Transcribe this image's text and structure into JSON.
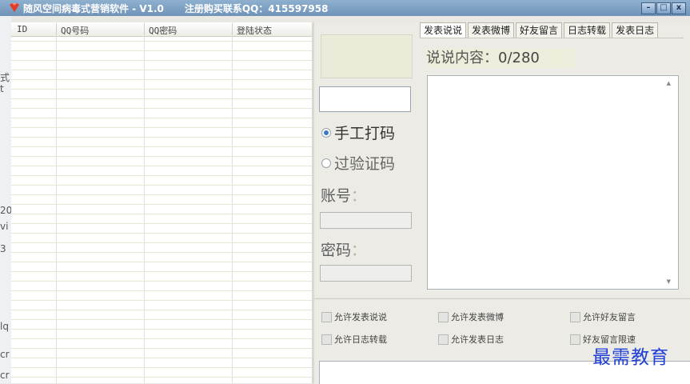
{
  "window": {
    "title": "随风空间病毒式营销软件 - V1.0",
    "contact": "注册购买联系QQ：415597958",
    "controls": [
      "–",
      "□",
      "x"
    ]
  },
  "left_strip_chars": [
    "式",
    "t",
    "20",
    "vi",
    "3",
    "lq",
    "cr",
    "cr"
  ],
  "account_table": {
    "columns": [
      "ID",
      "QQ号码",
      "QQ密码",
      "登陆状态"
    ],
    "rows": []
  },
  "login": {
    "radio_manual": "手工打码",
    "radio_auto": "过验证码",
    "account_label": "账号",
    "password_label": "密码",
    "colon": "："
  },
  "tabs": [
    "发表说说",
    "发表微博",
    "好友留言",
    "日志转载",
    "发表日志"
  ],
  "post": {
    "counter_label": "说说内容：",
    "counter_value": "0/280"
  },
  "options": {
    "allow_post_shuoshuo": "允许发表说说",
    "allow_post_weibo": "允许发表微博",
    "allow_friend_message": "允许好友留言",
    "allow_blog_repost": "允许日志转载",
    "allow_post_blog": "允许发表日志",
    "friend_message_speed_limit": "好友留言限速"
  },
  "watermark": "最需教育",
  "colors": {
    "titlebar": "#7ea3c8",
    "watermark": "#1f3fd8",
    "radio_selected": "#3a77c5"
  }
}
